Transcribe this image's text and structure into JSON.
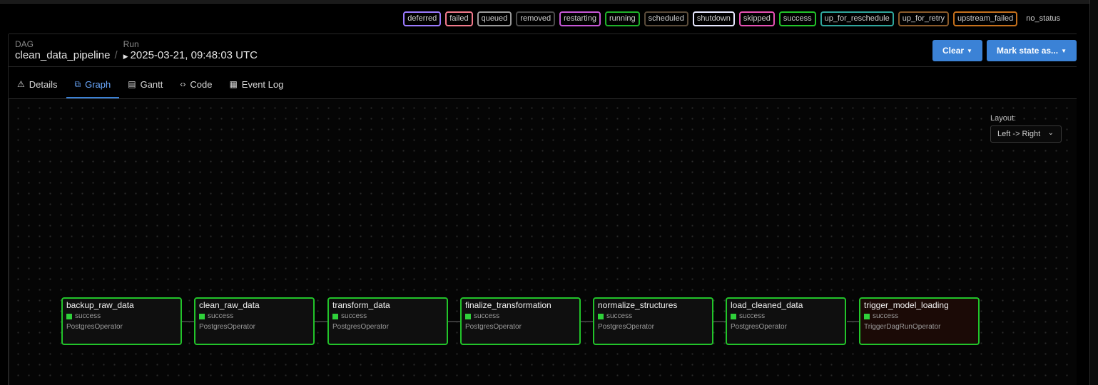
{
  "legend": [
    {
      "label": "deferred",
      "color": "#9c7bff"
    },
    {
      "label": "failed",
      "color": "#f27a8c"
    },
    {
      "label": "queued",
      "color": "#9a9a9a"
    },
    {
      "label": "removed",
      "color": "#4a4a4a"
    },
    {
      "label": "restarting",
      "color": "#c657d6"
    },
    {
      "label": "running",
      "color": "#1fb22a"
    },
    {
      "label": "scheduled",
      "color": "#5a4b3a"
    },
    {
      "label": "shutdown",
      "color": "#e8e8ff"
    },
    {
      "label": "skipped",
      "color": "#e752b5"
    },
    {
      "label": "success",
      "color": "#22c42a"
    },
    {
      "label": "up_for_reschedule",
      "color": "#2fa69c"
    },
    {
      "label": "up_for_retry",
      "color": "#8a5a2a"
    },
    {
      "label": "upstream_failed",
      "color": "#c5701c"
    },
    {
      "label": "no_status",
      "color": "transparent"
    }
  ],
  "breadcrumb": {
    "dag_label": "DAG",
    "dag_value": "clean_data_pipeline",
    "separator": "/",
    "run_label": "Run",
    "run_value": "2025-03-21, 09:48:03 UTC"
  },
  "actions": {
    "clear_label": "Clear",
    "mark_state_label": "Mark state as..."
  },
  "tabs": [
    {
      "label": "Details",
      "icon": "warning-icon",
      "glyph": "⚠"
    },
    {
      "label": "Graph",
      "icon": "graph-icon",
      "glyph": "⧉",
      "active": true
    },
    {
      "label": "Gantt",
      "icon": "gantt-icon",
      "glyph": "▤"
    },
    {
      "label": "Code",
      "icon": "code-icon",
      "glyph": "‹›"
    },
    {
      "label": "Event Log",
      "icon": "log-icon",
      "glyph": "▦"
    }
  ],
  "layout_control": {
    "label": "Layout:",
    "value": "Left -> Right"
  },
  "nodes": [
    {
      "name": "backup_raw_data",
      "status": "success",
      "operator": "PostgresOperator"
    },
    {
      "name": "clean_raw_data",
      "status": "success",
      "operator": "PostgresOperator"
    },
    {
      "name": "transform_data",
      "status": "success",
      "operator": "PostgresOperator"
    },
    {
      "name": "finalize_transformation",
      "status": "success",
      "operator": "PostgresOperator"
    },
    {
      "name": "normalize_structures",
      "status": "success",
      "operator": "PostgresOperator"
    },
    {
      "name": "load_cleaned_data",
      "status": "success",
      "operator": "PostgresOperator"
    },
    {
      "name": "trigger_model_loading",
      "status": "success",
      "operator": "TriggerDagRunOperator"
    }
  ]
}
